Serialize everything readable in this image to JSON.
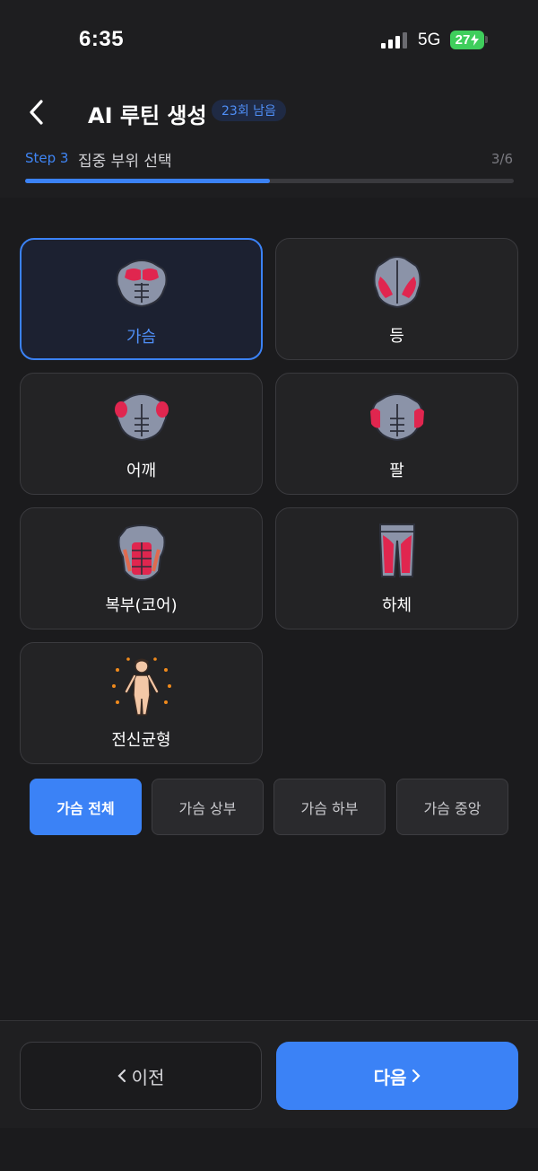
{
  "status": {
    "time": "6:35",
    "network": "5G",
    "battery": "27"
  },
  "header": {
    "back_icon": "chevron-left-icon",
    "title": "AI 루틴 생성",
    "remaining": "23회 남음",
    "step_label": "Step 3",
    "step_name": "집중 부위 선택",
    "step_count": "3/6",
    "progress": 0.5
  },
  "parts": [
    {
      "label": "가슴",
      "icon": "chest-muscle-icon",
      "selected": true
    },
    {
      "label": "등",
      "icon": "back-muscle-icon",
      "selected": false
    },
    {
      "label": "어깨",
      "icon": "shoulder-muscle-icon",
      "selected": false
    },
    {
      "label": "팔",
      "icon": "arm-muscle-icon",
      "selected": false
    },
    {
      "label": "복부(코어)",
      "icon": "abs-muscle-icon",
      "selected": false
    },
    {
      "label": "하체",
      "icon": "legs-muscle-icon",
      "selected": false
    },
    {
      "label": "전신균형",
      "icon": "full-body-icon",
      "selected": false
    }
  ],
  "sub_options": [
    {
      "label": "가슴 전체",
      "active": true
    },
    {
      "label": "가슴 상부",
      "active": false
    },
    {
      "label": "가슴 하부",
      "active": false
    },
    {
      "label": "가슴 중앙",
      "active": false
    }
  ],
  "footer": {
    "prev_label": "이전",
    "next_label": "다음"
  },
  "colors": {
    "accent": "#3b82f6",
    "muscle_highlight": "#e0264f",
    "body": "#8b93a8"
  }
}
